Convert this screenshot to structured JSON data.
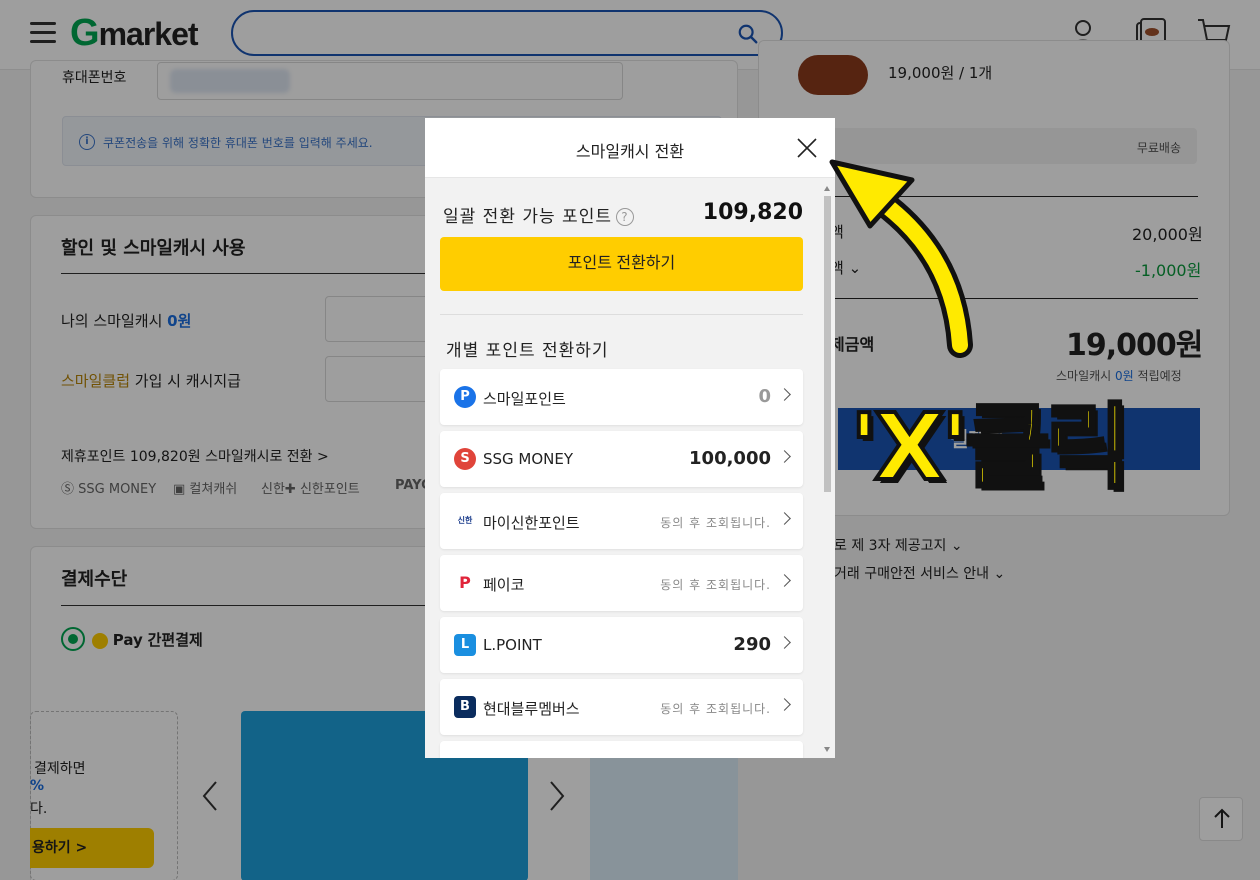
{
  "header": {
    "logo_g": "G",
    "logo_rest": "market",
    "search": {
      "placeholder": ""
    },
    "icons": [
      "menu-icon",
      "search-icon",
      "user-icon",
      "recent-icon",
      "cart-icon"
    ]
  },
  "left": {
    "phone_label": "휴대폰번호",
    "info_text": "쿠폰전송을 위해 정확한 휴대폰 번호를 입력해 주세요.",
    "discount_title": "할인 및 스마일캐시 사용",
    "my_cash_label": "나의 스마일캐시",
    "my_cash_value": "0원",
    "club_label_highlight": "스마일클럽",
    "club_label_rest": " 가입 시 캐시지급",
    "partner_text": "제휴포인트 109,820원 스마일캐시로 전환 >",
    "partners": [
      "SSG MONEY",
      "컬쳐캐쉬",
      "신한포인트",
      "PAYC"
    ],
    "payment_title": "결제수단",
    "smilepay_label": "Pay",
    "smilepay_rest": "간편결제",
    "promo_line1": "결제하면",
    "promo_line2": "%",
    "promo_line3": "다.",
    "promo_button": "용하기 >"
  },
  "right": {
    "order_price_line": "19,000원 / 1개",
    "free_shipping": "무료배송",
    "price_label": "액",
    "price_value": "20,000원",
    "discount_label": "액",
    "discount_value": "-1,000원",
    "total_label": "제금액",
    "total_value": "19,000원",
    "cash_note_prefix": "스마일캐시",
    "cash_note_value": "0원",
    "cash_note_suffix": "적립예정",
    "pay_button": "결제하",
    "third_party": "로 제 3자 제공고지",
    "safe_service": "거래 구매안전 서비스 안내"
  },
  "modal": {
    "title": "스마일캐시 전환",
    "bulk_label": "일괄 전환 가능 포인트",
    "bulk_help": "?",
    "bulk_value": "109,820",
    "convert_button": "포인트 전환하기",
    "individual_title": "개별 포인트 전환하기",
    "points": [
      {
        "name": "스마일포인트",
        "icon": "P",
        "color": "#1a73e8",
        "value": "0",
        "note": ""
      },
      {
        "name": "SSG MONEY",
        "icon": "S",
        "color": "#e0443a",
        "value": "100,000",
        "note": ""
      },
      {
        "name": "마이신한포인트",
        "icon": "신한",
        "color": "#ffffff",
        "value": "",
        "note": "동의 후 조회됩니다."
      },
      {
        "name": "페이코",
        "icon": "P",
        "color": "#ffffff",
        "value": "",
        "note": "동의 후 조회됩니다."
      },
      {
        "name": "L.POINT",
        "icon": "L",
        "color": "#1a8fe0",
        "value": "290",
        "note": ""
      },
      {
        "name": "현대블루멤버스",
        "icon": "B",
        "color": "#0a2c5e",
        "value": "",
        "note": "동의 후 조회됩니다."
      }
    ]
  },
  "annotation": {
    "text": "'X'클릭"
  }
}
